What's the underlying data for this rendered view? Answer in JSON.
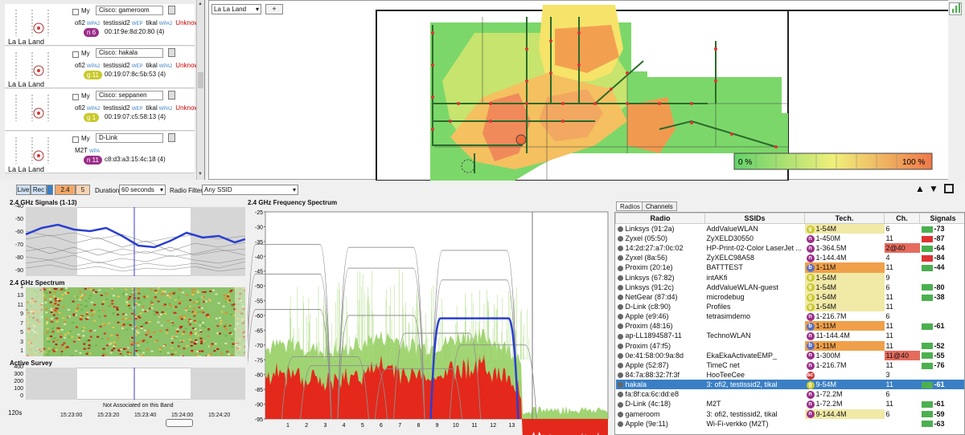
{
  "ap_cards": [
    {
      "my_label": "My",
      "name": "Cisco: gameroom",
      "location": "La La Land",
      "ssids": [
        {
          "t": "ofi2",
          "c": "#111"
        },
        {
          "t": "WPA2",
          "c": "#3a7fc4",
          "s": 1
        },
        {
          "t": "testissid2",
          "c": "#111"
        },
        {
          "t": "WEP",
          "c": "#3a7fc4",
          "s": 1
        },
        {
          "t": "tikal",
          "c": "#111"
        },
        {
          "t": "WPA2",
          "c": "#3a7fc4",
          "s": 1
        },
        {
          "t": "Unknown",
          "c": "#c00"
        },
        {
          "t": "WPA2",
          "c": "#3a7fc4",
          "s": 1
        }
      ],
      "pill": "n 6",
      "pill_color": "#9b2d8a",
      "mac": "00:1f:9e:8d:20:80 (4)"
    },
    {
      "my_label": "My",
      "name": "Cisco: hakala",
      "location": "La La Land",
      "ssids": [
        {
          "t": "ofi2",
          "c": "#111"
        },
        {
          "t": "WPA2",
          "c": "#3a7fc4",
          "s": 1
        },
        {
          "t": "testissid2",
          "c": "#111"
        },
        {
          "t": "WEP",
          "c": "#3a7fc4",
          "s": 1
        },
        {
          "t": "tikal",
          "c": "#111"
        },
        {
          "t": "WPA2",
          "c": "#3a7fc4",
          "s": 1
        },
        {
          "t": "Unknown",
          "c": "#c00"
        },
        {
          "t": "WPA2",
          "c": "#3a7fc4",
          "s": 1
        }
      ],
      "pill": "g 11",
      "pill_color": "#c9c92a",
      "mac": "00:19:07:8c:5b:53 (4)"
    },
    {
      "my_label": "My",
      "name": "Cisco: seppanen",
      "location": "",
      "ssids": [
        {
          "t": "ofi2",
          "c": "#111"
        },
        {
          "t": "WPA2",
          "c": "#3a7fc4",
          "s": 1
        },
        {
          "t": "testissid2",
          "c": "#111"
        },
        {
          "t": "WEP",
          "c": "#3a7fc4",
          "s": 1
        },
        {
          "t": "tikal",
          "c": "#111"
        },
        {
          "t": "WPA2",
          "c": "#3a7fc4",
          "s": 1
        },
        {
          "t": "Unknown",
          "c": "#c00"
        },
        {
          "t": "WPA2",
          "c": "#3a7fc4",
          "s": 1
        }
      ],
      "pill": "g 1",
      "pill_color": "#c9c92a",
      "mac": "00:19:07:c5:58:13 (4)"
    },
    {
      "my_label": "My",
      "name": "D-Link",
      "location": "La La Land",
      "ssids": [
        {
          "t": "M2T",
          "c": "#111"
        },
        {
          "t": "WPA",
          "c": "#3a7fc4",
          "s": 1
        }
      ],
      "pill": "n 11",
      "pill_color": "#9b2d8a",
      "mac": "c8:d3:a3:15:4c:18 (4)"
    }
  ],
  "map": {
    "selector": "La La Land",
    "add_label": "+",
    "legend_min": "0 %",
    "legend_max": "100 %"
  },
  "toolbar": {
    "live": "Live",
    "rec": "Rec",
    "band24": "2.4",
    "band5": "5",
    "duration_label": "Duration",
    "duration_value": "60 seconds",
    "radio_filter_label": "Radio Filter",
    "radio_filter_value": "Any SSID"
  },
  "signals_chart": {
    "title": "2.4 GHz Signals (1-13)",
    "yticks": [
      "-40",
      "-50",
      "-60",
      "-70",
      "-80",
      "-90"
    ]
  },
  "spectrum_small": {
    "title": "2.4 GHz Spectrum",
    "yticks": [
      "1",
      "13",
      "11",
      "9",
      "7",
      "5",
      "3",
      "1"
    ]
  },
  "survey": {
    "title": "Active Survey",
    "yticks": [
      "400",
      "300",
      "200",
      "100",
      "0"
    ],
    "note": "Not Associated on this Band",
    "xticks": [
      "15:23:00",
      "15:23:20",
      "15:23:40",
      "15:24:00",
      "15:24:20"
    ],
    "span": "120s"
  },
  "chart_data": {
    "type": "area",
    "title": "2.4 GHz Frequency Spectrum",
    "ylim": [
      -95,
      -25
    ],
    "yticks": [
      -25,
      -30,
      -35,
      -40,
      -45,
      -50,
      -55,
      -60,
      -65,
      -70,
      -75,
      -80,
      -85,
      -90,
      -95
    ],
    "x_channels": [
      "1",
      "2",
      "3",
      "4",
      "5",
      "6",
      "7",
      "8",
      "9",
      "10",
      "11",
      "12",
      "13"
    ],
    "highlight": {
      "name": "hakala",
      "channel_from": 9,
      "channel_to": 13,
      "level": -61
    }
  },
  "tabs": {
    "radios": "Radios",
    "channels": "Channels"
  },
  "table": {
    "headers": [
      "Radio",
      "SSIDs",
      "Tech.",
      "Ch.",
      "Signals"
    ],
    "rows": [
      {
        "radio": "Linksys (91:2a)",
        "ssid": "AddValueWLAN",
        "tl": "g",
        "tc": "#c9c92a",
        "tech": "1-54M",
        "tb": "#f1e9a6",
        "ch": "6",
        "chb": "",
        "sig": "-73",
        "sb": "#4caf50"
      },
      {
        "radio": "Zyxel (05:50)",
        "ssid": "ZyXELD30550",
        "tl": "n",
        "tc": "#9b2d8a",
        "tech": "1-450M",
        "tb": "",
        "ch": "11",
        "chb": "",
        "sig": "-87",
        "sb": "#d33"
      },
      {
        "radio": "14:2d:27:a7:0c:02",
        "ssid": "HP-Print-02-Color LaserJet ...",
        "tl": "n",
        "tc": "#9b2d8a",
        "tech": "1-364.5M",
        "tb": "",
        "ch": "2@40",
        "chb": "#e56b5e",
        "sig": "-64",
        "sb": "#4caf50"
      },
      {
        "radio": "Zyxel (8a:56)",
        "ssid": "ZyXELC98A58",
        "tl": "n",
        "tc": "#9b2d8a",
        "tech": "1-144.4M",
        "tb": "",
        "ch": "4",
        "chb": "",
        "sig": "-84",
        "sb": "#d33"
      },
      {
        "radio": "Proxim (20:1e)",
        "ssid": "BATTTEST",
        "tl": "b",
        "tc": "#5b6fc0",
        "tech": "1-11M",
        "tb": "#f0a04a",
        "ch": "11",
        "chb": "",
        "sig": "-44",
        "sb": "#4caf50"
      },
      {
        "radio": "Linksys (67:82)",
        "ssid": "intAKfi",
        "tl": "g",
        "tc": "#c9c92a",
        "tech": "1-54M",
        "tb": "#f1e9a6",
        "ch": "9",
        "chb": "",
        "sig": "",
        "sb": ""
      },
      {
        "radio": "Linksys (91:2c)",
        "ssid": "AddValueWLAN-guest",
        "tl": "g",
        "tc": "#c9c92a",
        "tech": "1-54M",
        "tb": "#f1e9a6",
        "ch": "6",
        "chb": "",
        "sig": "-80",
        "sb": "#4caf50"
      },
      {
        "radio": "NetGear (87:d4)",
        "ssid": "microdebug",
        "tl": "g",
        "tc": "#c9c92a",
        "tech": "1-54M",
        "tb": "#f1e9a6",
        "ch": "11",
        "chb": "",
        "sig": "-38",
        "sb": "#4caf50"
      },
      {
        "radio": "D-Link (c8:90)",
        "ssid": "Profiles",
        "tl": "g",
        "tc": "#c9c92a",
        "tech": "1-54M",
        "tb": "#f1e9a6",
        "ch": "11",
        "chb": "",
        "sig": "",
        "sb": ""
      },
      {
        "radio": "Apple (e9:46)",
        "ssid": "tetrasimdemo",
        "tl": "n",
        "tc": "#9b2d8a",
        "tech": "1-216.7M",
        "tb": "",
        "ch": "6",
        "chb": "",
        "sig": "",
        "sb": ""
      },
      {
        "radio": "Proxim (48:16)",
        "ssid": "",
        "tl": "b",
        "tc": "#5b6fc0",
        "tech": "1-11M",
        "tb": "#f0a04a",
        "ch": "11",
        "chb": "",
        "sig": "-61",
        "sb": "#4caf50"
      },
      {
        "radio": "ap-LL1894587-11",
        "ssid": "TechnoWLAN",
        "tl": "n",
        "tc": "#9b2d8a",
        "tech": "11-144.4M",
        "tb": "",
        "ch": "11",
        "chb": "",
        "sig": "",
        "sb": ""
      },
      {
        "radio": "Proxim (47:f5)",
        "ssid": "",
        "tl": "b",
        "tc": "#5b6fc0",
        "tech": "1-11M",
        "tb": "#f0a04a",
        "ch": "11",
        "chb": "",
        "sig": "-52",
        "sb": "#4caf50"
      },
      {
        "radio": "0e:41:58:00:9a:8d",
        "ssid": "EkaEkaActivateEMP_",
        "tl": "n",
        "tc": "#9b2d8a",
        "tech": "1-300M",
        "tb": "",
        "ch": "11@40",
        "chb": "#e56b5e",
        "sig": "-55",
        "sb": "#4caf50"
      },
      {
        "radio": "Apple (52:87)",
        "ssid": "TimeC net",
        "tl": "n",
        "tc": "#9b2d8a",
        "tech": "1-216.7M",
        "tb": "",
        "ch": "11",
        "chb": "",
        "sig": "-76",
        "sb": "#4caf50"
      },
      {
        "radio": "84:7a:88:32:7f:3f",
        "ssid": "HooTeeCee",
        "tl": "ac",
        "tc": "#c33",
        "tech": "",
        "tb": "",
        "ch": "3",
        "chb": "",
        "sig": "",
        "sb": ""
      },
      {
        "radio": "hakala",
        "ssid": "3: ofi2, testissid2, tikal",
        "tl": "g",
        "tc": "#c9c92a",
        "tech": "9-54M",
        "tb": "",
        "ch": "11",
        "chb": "",
        "sig": "-61",
        "sb": "#4caf50",
        "sel": true
      },
      {
        "radio": "fa:8f:ca:6c:dd:e8",
        "ssid": "",
        "tl": "n",
        "tc": "#9b2d8a",
        "tech": "1-72.2M",
        "tb": "",
        "ch": "6",
        "chb": "",
        "sig": "",
        "sb": ""
      },
      {
        "radio": "D-Link (4c:18)",
        "ssid": "M2T",
        "tl": "n",
        "tc": "#9b2d8a",
        "tech": "1-72.2M",
        "tb": "",
        "ch": "11",
        "chb": "",
        "sig": "-61",
        "sb": "#4caf50"
      },
      {
        "radio": "gameroom",
        "ssid": "3: ofi2, testissid2, tikal",
        "tl": "n",
        "tc": "#9b2d8a",
        "tech": "9-144.4M",
        "tb": "#f1e9a6",
        "ch": "6",
        "chb": "",
        "sig": "-59",
        "sb": "#4caf50"
      },
      {
        "radio": "Apple (9e:11)",
        "ssid": "Wi-Fi-verkko (M2T)",
        "tl": "",
        "tc": "",
        "tech": "",
        "tb": "",
        "ch": "",
        "chb": "",
        "sig": "-63",
        "sb": "#4caf50"
      }
    ]
  }
}
